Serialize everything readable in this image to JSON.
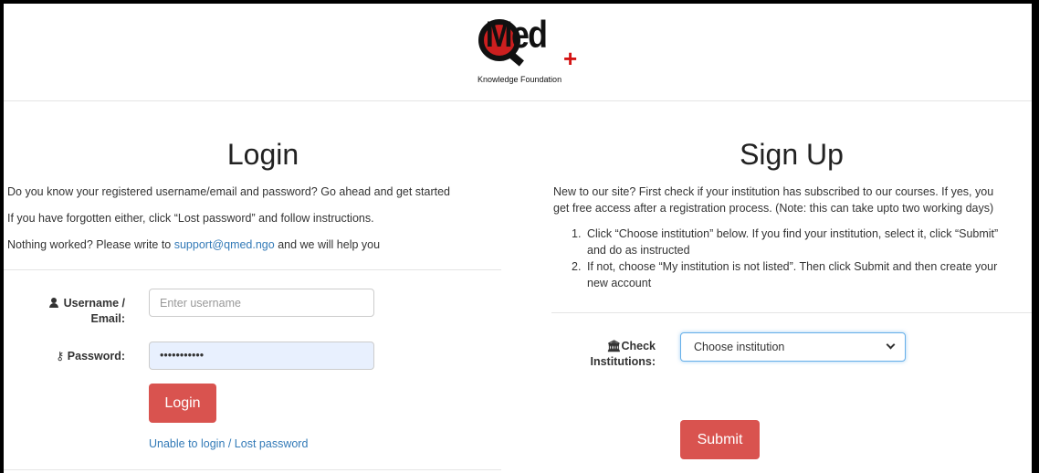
{
  "brand": {
    "logo_subtitle": "Knowledge Foundation"
  },
  "login": {
    "title": "Login",
    "line1": "Do you know your registered username/email and password? Go ahead and get started",
    "line2": "If you have forgotten either, click “Lost password” and follow instructions.",
    "line3_prefix": "Nothing worked? Please write to ",
    "support_email": "support@qmed.ngo",
    "line3_suffix": " and we will help you",
    "username_label_1": "Username /",
    "username_label_2": "Email:",
    "username_placeholder": "Enter username",
    "password_label": "Password:",
    "password_value": "•••••••••••",
    "button_label": "Login",
    "lost_password_link": "Unable to login / Lost password"
  },
  "signup": {
    "title": "Sign Up",
    "intro_1": "New to our site? First check if your institution has subscribed to our courses. If yes, you",
    "intro_2": "get free access after a registration process. (Note: this can take upto two working days)",
    "steps": [
      {
        "num": "1.",
        "line1": "Click “Choose institution” below. If you find your institution, select it, click “Submit”",
        "line2": "and do as instructed"
      },
      {
        "num": "2.",
        "line1": "If not, choose “My institution is not listed”. Then click Submit and then create your",
        "line2": "new account"
      }
    ],
    "check_label_1": "Check",
    "check_label_2": "Institutions:",
    "select_value": "Choose institution",
    "submit_label": "Submit"
  },
  "colors": {
    "accent_red": "#d9534f",
    "link_blue": "#337ab7",
    "autofill_blue": "#e8f0fe"
  },
  "icons": [
    "user-icon",
    "key-icon",
    "bank-icon",
    "chevron-down-icon"
  ]
}
